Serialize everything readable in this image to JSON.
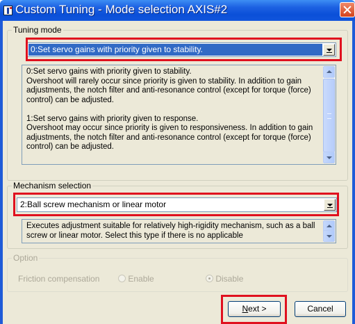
{
  "window": {
    "title": "Custom Tuning - Mode selection AXIS#2"
  },
  "tuning_mode": {
    "legend": "Tuning mode",
    "selected_value": "0:Set servo gains with priority given to stability.",
    "description": "0:Set servo gains with priority given to stability.\nOvershoot will rarely occur since priority is given to stability. In addition to gain adjustments, the notch filter and anti-resonance control (except for torque (force) control) can be adjusted.\n\n1:Set servo gains with priority given to response.\nOvershoot may occur since priority is given to responsiveness. In addition to gain adjustments, the notch filter and anti-resonance control (except for torque (force) control) can be adjusted."
  },
  "mechanism_selection": {
    "legend": "Mechanism selection",
    "selected_value": "2:Ball screw mechanism or linear motor",
    "description": "Executes adjustment suitable for relatively high-rigidity mechanism, such as a ball screw or linear motor. Select this type if there is no applicable"
  },
  "option": {
    "legend": "Option",
    "friction_label": "Friction compensation",
    "enable_label": "Enable",
    "disable_label": "Disable",
    "selected": "Disable"
  },
  "buttons": {
    "next_mnemonic": "N",
    "next_rest": "ext >",
    "cancel_label": "Cancel"
  },
  "colors": {
    "title_bar": "#0a4fd8",
    "highlight": "#e0101e",
    "selection": "#316ac5",
    "dialog_bg": "#ece9d8"
  }
}
